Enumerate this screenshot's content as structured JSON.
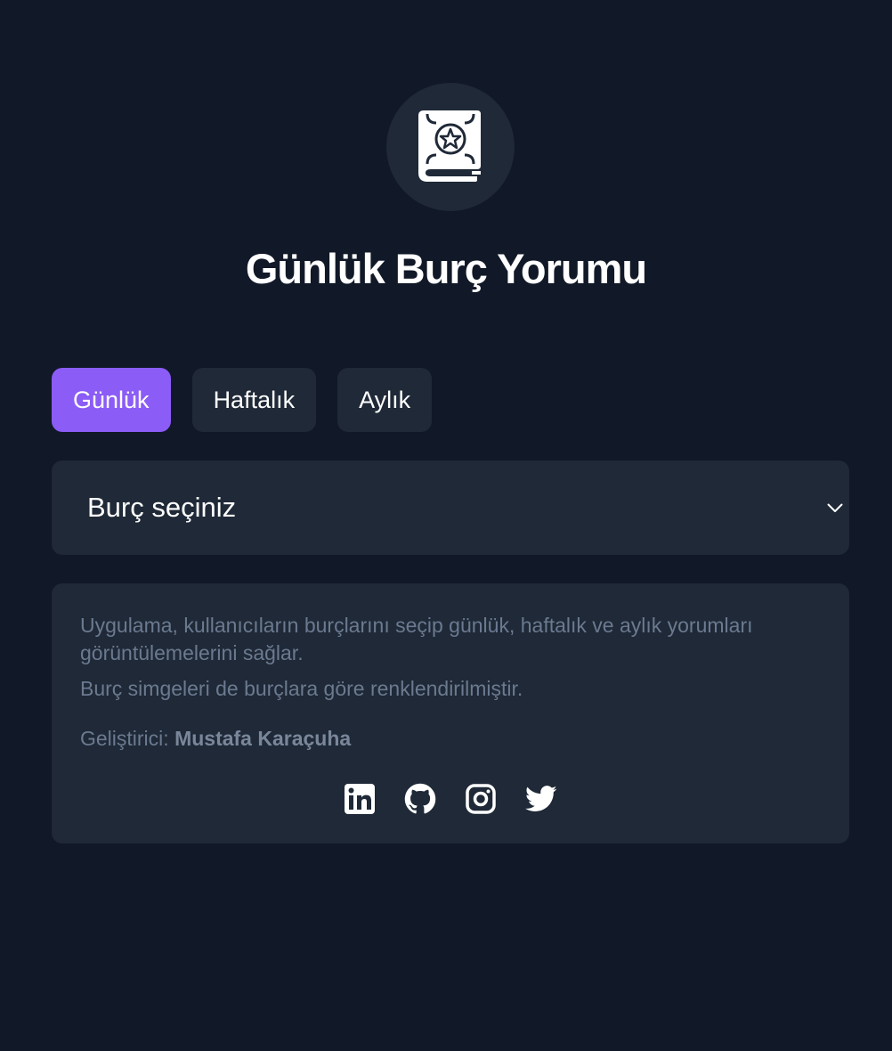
{
  "header": {
    "logo_icon": "horoscope-book-icon",
    "title": "Günlük Burç Yorumu"
  },
  "tabs": [
    {
      "label": "Günlük",
      "active": true
    },
    {
      "label": "Haftalık",
      "active": false
    },
    {
      "label": "Aylık",
      "active": false
    }
  ],
  "zodiac_select": {
    "selected": "Burç seçiniz",
    "icon": "chevron-down-icon"
  },
  "info": {
    "description": "Uygulama, kullanıcıların burçlarını seçip günlük, haftalık ve aylık yorumları görüntülemelerini sağlar.",
    "note": "Burç simgeleri de burçlara göre renklendirilmiştir.",
    "developer_label": "Geliştirici:",
    "developer_name": "Mustafa Karaçuha"
  },
  "socials": [
    {
      "icon": "linkedin-icon"
    },
    {
      "icon": "github-icon"
    },
    {
      "icon": "instagram-icon"
    },
    {
      "icon": "twitter-icon"
    }
  ],
  "colors": {
    "background": "#111827",
    "card": "#1f2937",
    "accent": "#8b5cf6",
    "muted_text": "#6b7a90"
  }
}
